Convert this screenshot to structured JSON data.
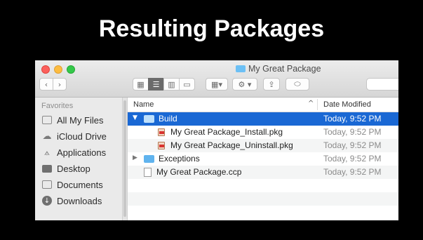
{
  "slide": {
    "title": "Resulting Packages"
  },
  "window": {
    "title": "My Great Package",
    "toolbar": {
      "back_icon": "‹",
      "forward_icon": "›",
      "view_icons": "▦",
      "view_list": "☰",
      "view_columns": "▥",
      "view_coverflow": "▭",
      "arrange": "▾",
      "action": "⚙ ▾",
      "share": "⇪",
      "tags": "⬭"
    }
  },
  "sidebar": {
    "heading": "Favorites",
    "items": [
      {
        "label": "All My Files",
        "icon": "all-files-icon"
      },
      {
        "label": "iCloud Drive",
        "icon": "cloud-icon"
      },
      {
        "label": "Applications",
        "icon": "applications-icon"
      },
      {
        "label": "Desktop",
        "icon": "desktop-icon"
      },
      {
        "label": "Documents",
        "icon": "documents-icon"
      },
      {
        "label": "Downloads",
        "icon": "downloads-icon"
      }
    ]
  },
  "list": {
    "columns": {
      "name": "Name",
      "date": "Date Modified",
      "sort_indicator": "^"
    },
    "rows": [
      {
        "name": "Build",
        "date": "Today, 9:52 PM",
        "kind": "folder",
        "expanded": true,
        "selected": true
      },
      {
        "name": "My Great Package_Install.pkg",
        "date": "Today, 9:52 PM",
        "kind": "pkg"
      },
      {
        "name": "My Great Package_Uninstall.pkg",
        "date": "Today, 9:52 PM",
        "kind": "pkg"
      },
      {
        "name": "Exceptions",
        "date": "Today, 9:52 PM",
        "kind": "folder",
        "expanded": false
      },
      {
        "name": "My Great Package.ccp",
        "date": "Today, 9:52 PM",
        "kind": "file"
      }
    ]
  },
  "colors": {
    "selection": "#1a68d4",
    "folder": "#5fb3ee",
    "background": "#000000"
  }
}
